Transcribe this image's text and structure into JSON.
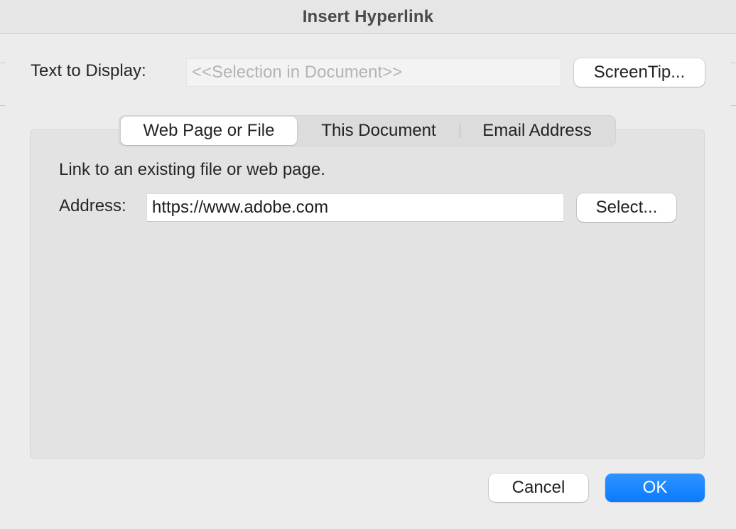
{
  "window": {
    "title": "Insert Hyperlink"
  },
  "display": {
    "label": "Text to Display:",
    "placeholder": "<<Selection in Document>>",
    "screentip_label": "ScreenTip..."
  },
  "tabs": [
    {
      "label": "Web Page or File",
      "selected": true
    },
    {
      "label": "This Document",
      "selected": false
    },
    {
      "label": "Email Address",
      "selected": false
    }
  ],
  "web_page": {
    "description": "Link to an existing file or web page.",
    "address_label": "Address:",
    "address_value": "https://www.adobe.com",
    "select_label": "Select..."
  },
  "footer": {
    "cancel_label": "Cancel",
    "ok_label": "OK"
  },
  "colors": {
    "accent": "#0a7bff",
    "background": "#ececec",
    "panel": "#e3e3e3"
  }
}
